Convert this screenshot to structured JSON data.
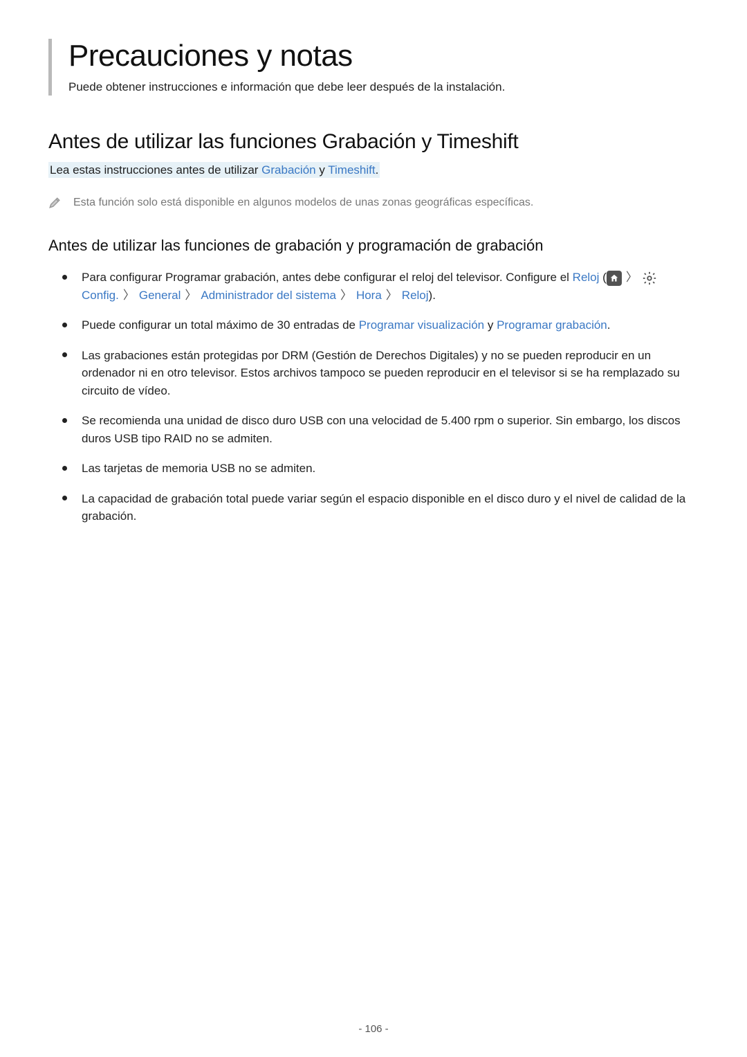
{
  "title": "Precauciones y notas",
  "subtitle": "Puede obtener instrucciones e información que debe leer después de la instalación.",
  "h2": "Antes de utilizar las funciones Grabación y Timeshift",
  "lead": {
    "prefix": "Lea estas instrucciones antes de utilizar ",
    "link_a": "Grabación",
    "mid": " y ",
    "link_b": "Timeshift",
    "suffix": "."
  },
  "note": "Esta función solo está disponible en algunos modelos de unas zonas geográficas específicas.",
  "h3": "Antes de utilizar las funciones de grabación y programación de grabación",
  "bullets": [
    {
      "pre": "Para configurar Programar grabación, antes debe configurar el reloj del televisor. Configure el ",
      "reloj": "Reloj",
      "open": " (",
      "path": {
        "config": "Config.",
        "general": "General",
        "admin": "Administrador del sistema",
        "hora": "Hora",
        "reloj2": "Reloj"
      },
      "close": ")."
    },
    {
      "pre": "Puede configurar un total máximo de 30 entradas de ",
      "l1": "Programar visualización",
      "mid": " y ",
      "l2": "Programar grabación",
      "suffix": "."
    },
    {
      "text": "Las grabaciones están protegidas por DRM (Gestión de Derechos Digitales) y no se pueden reproducir en un ordenador ni en otro televisor. Estos archivos tampoco se pueden reproducir en el televisor si se ha remplazado su circuito de vídeo."
    },
    {
      "text": "Se recomienda una unidad de disco duro USB con una velocidad de 5.400 rpm o superior. Sin embargo, los discos duros USB tipo RAID no se admiten."
    },
    {
      "text": "Las tarjetas de memoria USB no se admiten."
    },
    {
      "text": "La capacidad de grabación total puede variar según el espacio disponible en el disco duro y el nivel de calidad de la grabación."
    }
  ],
  "page_number": "- 106 -"
}
